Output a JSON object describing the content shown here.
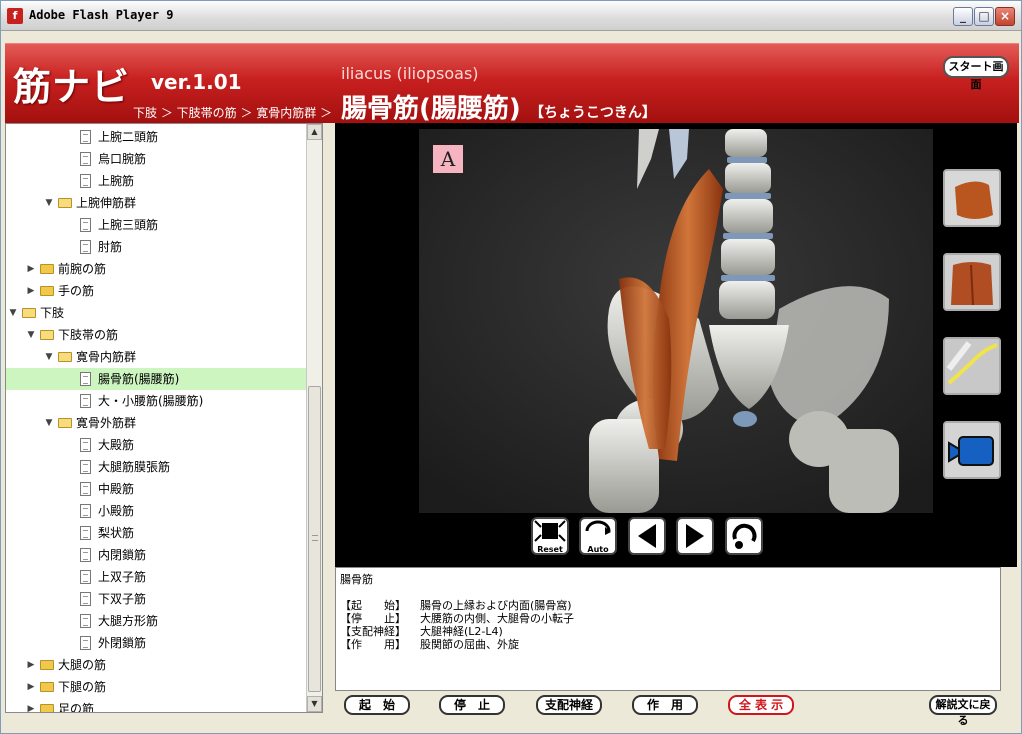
{
  "window": {
    "title": "Adobe Flash Player 9"
  },
  "header": {
    "brand": "筋ナビ",
    "version": "ver.1.01",
    "breadcrumb": "下肢 ＞ 下肢帯の筋 ＞ 寛骨内筋群 ＞",
    "latin_name": "iliacus (iliopsoas)",
    "muscle_name": "腸骨筋(腸腰筋)",
    "reading": "【ちょうこつきん】",
    "start_button": "スタート画面"
  },
  "tree": {
    "items": [
      {
        "label": "上腕二頭筋",
        "kind": "page",
        "level": 3
      },
      {
        "label": "烏口腕筋",
        "kind": "page",
        "level": 3
      },
      {
        "label": "上腕筋",
        "kind": "page",
        "level": 3
      },
      {
        "label": "上腕伸筋群",
        "kind": "folder-open",
        "level": 2
      },
      {
        "label": "上腕三頭筋",
        "kind": "page",
        "level": 3
      },
      {
        "label": "肘筋",
        "kind": "page",
        "level": 3
      },
      {
        "label": "前腕の筋",
        "kind": "folder",
        "level": 1
      },
      {
        "label": "手の筋",
        "kind": "folder",
        "level": 1
      },
      {
        "label": "下肢",
        "kind": "folder-open",
        "level": 0
      },
      {
        "label": "下肢帯の筋",
        "kind": "folder-open",
        "level": 1
      },
      {
        "label": "寛骨内筋群",
        "kind": "folder-open",
        "level": 2
      },
      {
        "label": "腸骨筋(腸腰筋)",
        "kind": "page",
        "level": 3,
        "selected": true
      },
      {
        "label": "大・小腰筋(腸腰筋)",
        "kind": "page",
        "level": 3
      },
      {
        "label": "寛骨外筋群",
        "kind": "folder-open",
        "level": 2
      },
      {
        "label": "大殿筋",
        "kind": "page",
        "level": 3
      },
      {
        "label": "大腿筋膜張筋",
        "kind": "page",
        "level": 3
      },
      {
        "label": "中殿筋",
        "kind": "page",
        "level": 3
      },
      {
        "label": "小殿筋",
        "kind": "page",
        "level": 3
      },
      {
        "label": "梨状筋",
        "kind": "page",
        "level": 3
      },
      {
        "label": "内閉鎖筋",
        "kind": "page",
        "level": 3
      },
      {
        "label": "上双子筋",
        "kind": "page",
        "level": 3
      },
      {
        "label": "下双子筋",
        "kind": "page",
        "level": 3
      },
      {
        "label": "大腿方形筋",
        "kind": "page",
        "level": 3
      },
      {
        "label": "外閉鎖筋",
        "kind": "page",
        "level": 3
      },
      {
        "label": "大腿の筋",
        "kind": "folder",
        "level": 1
      },
      {
        "label": "下腿の筋",
        "kind": "folder",
        "level": 1
      },
      {
        "label": "足の筋",
        "kind": "folder",
        "level": 1
      }
    ]
  },
  "viewer": {
    "view_label": "A",
    "controls": {
      "reset": "Reset",
      "auto": "Auto"
    }
  },
  "description": {
    "title": "腸骨筋",
    "rows": [
      {
        "key": "【起　　始】",
        "value": "腸骨の上縁および内面(腸骨窩)"
      },
      {
        "key": "【停　　止】",
        "value": "大腰筋の内側、大腿骨の小転子"
      },
      {
        "key": "【支配神経】",
        "value": "大腿神経(L2-L4)"
      },
      {
        "key": "【作　　用】",
        "value": "股関節の屈曲、外旋"
      }
    ]
  },
  "buttons": {
    "origin": "起　始",
    "insertion": "停　止",
    "nerve": "支配神経",
    "action": "作　用",
    "show_all": "全 表 示",
    "back": "解説文に戻る"
  },
  "colors": {
    "header_red": "#c7201f",
    "selected_row": "#cdf5c0",
    "show_all_red": "#d0161c",
    "muscle": "#b5531f"
  }
}
